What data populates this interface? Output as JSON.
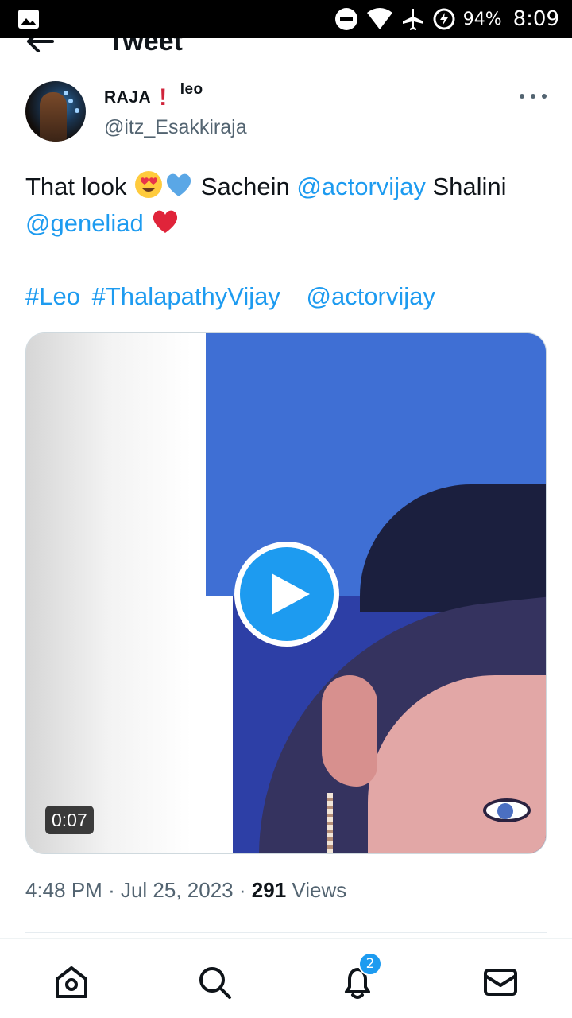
{
  "status_bar": {
    "battery_text": "94%",
    "time": "8:09"
  },
  "header": {
    "title": "Tweet"
  },
  "tweet": {
    "display_name": "RAJA",
    "name_tag": "leo",
    "handle": "@itz_Esakkiraja",
    "text_prefix": "That look",
    "text_word1": "Sachein",
    "mention1": "@actorvijay",
    "text_word2": "Shalini",
    "mention2": "@geneliad",
    "hashtag1": "#Leo",
    "hashtag2": "#ThalapathyVijay",
    "mention3": "@actorvijay",
    "video_duration": "0:07",
    "time": "4:48 PM",
    "date": "Jul 25, 2023",
    "views_count": "291",
    "views_label": "Views",
    "separator": "·"
  },
  "bottom_nav": {
    "notification_count": "2"
  },
  "colors": {
    "accent": "#1d9bf0",
    "text": "#0f1419",
    "secondary": "#536471",
    "heart": "#d0243b"
  }
}
